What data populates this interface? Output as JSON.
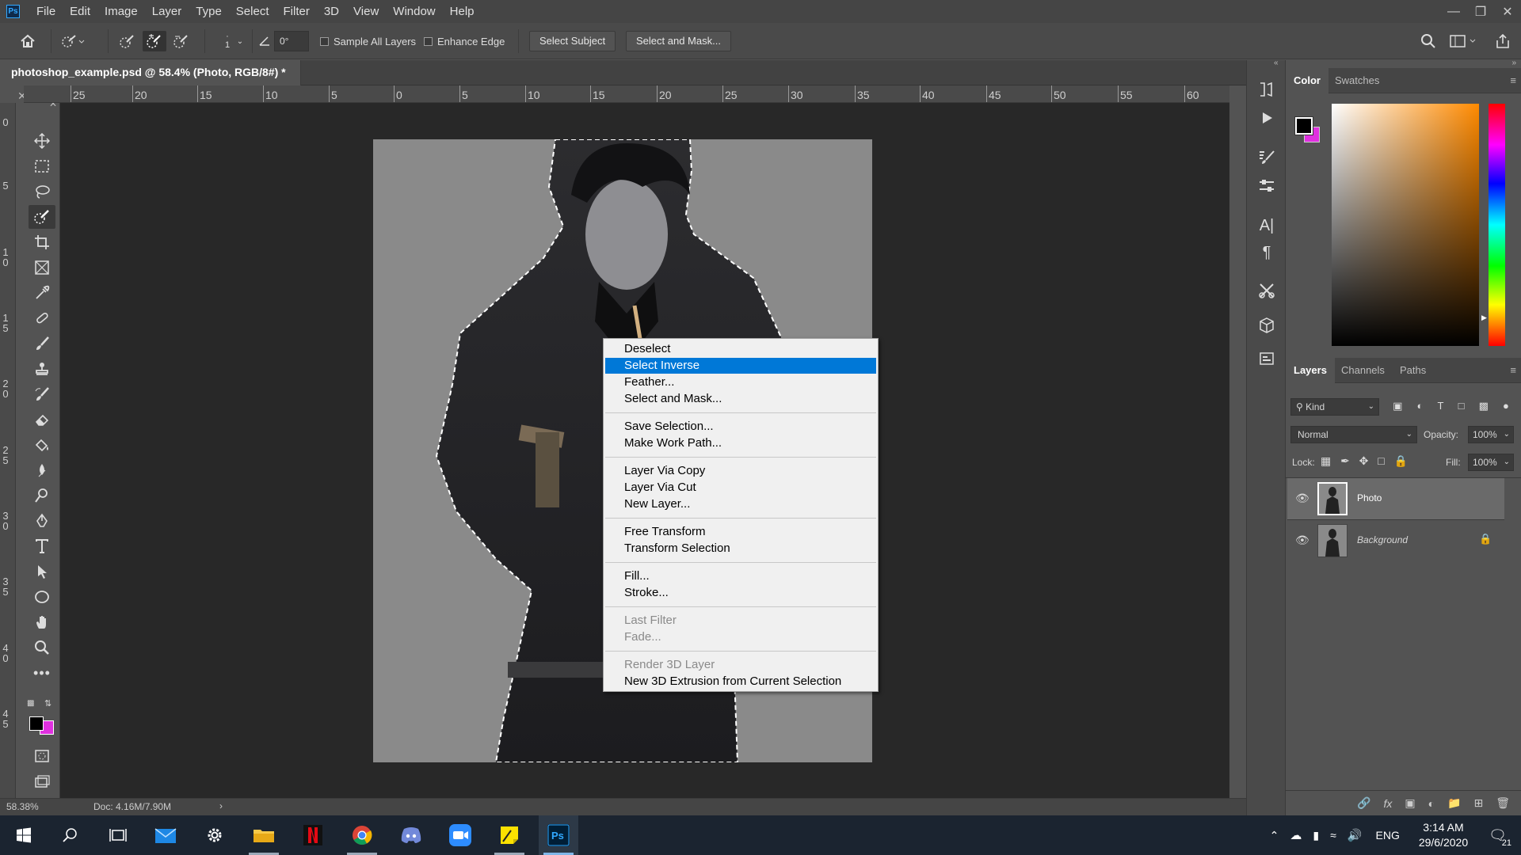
{
  "app": {
    "logo": "Ps"
  },
  "menu": [
    "File",
    "Edit",
    "Image",
    "Layer",
    "Type",
    "Select",
    "Filter",
    "3D",
    "View",
    "Window",
    "Help"
  ],
  "options": {
    "brush_size": "1",
    "angle": "0°",
    "sample_all_layers": "Sample All Layers",
    "enhance_edge": "Enhance Edge",
    "select_subject": "Select Subject",
    "select_and_mask": "Select and Mask..."
  },
  "document": {
    "tab_title": "photoshop_example.psd @ 58.4% (Photo, RGB/8#) *",
    "zoom": "58.38%",
    "doc_size": "Doc: 4.16M/7.90M"
  },
  "rulers": {
    "h": [
      "25",
      "20",
      "15",
      "10",
      "5",
      "0",
      "5",
      "10",
      "15",
      "20",
      "25",
      "30",
      "35",
      "40",
      "45",
      "50",
      "55",
      "60"
    ],
    "v": [
      "0",
      "5",
      "1\n0",
      "1\n5",
      "2\n0",
      "2\n5",
      "3\n0",
      "3\n5",
      "4\n0",
      "4\n5"
    ]
  },
  "context_menu": {
    "groups": [
      [
        "Deselect",
        "Select Inverse",
        "Feather...",
        "Select and Mask..."
      ],
      [
        "Save Selection...",
        "Make Work Path..."
      ],
      [
        "Layer Via Copy",
        "Layer Via Cut",
        "New Layer..."
      ],
      [
        "Free Transform",
        "Transform Selection"
      ],
      [
        "Fill...",
        "Stroke..."
      ],
      [
        "Last Filter",
        "Fade..."
      ],
      [
        "Render 3D Layer",
        "New 3D Extrusion from Current Selection"
      ]
    ],
    "highlighted": "Select Inverse",
    "disabled": [
      "Last Filter",
      "Fade...",
      "Render 3D Layer"
    ]
  },
  "color_panel": {
    "tabs": [
      "Color",
      "Swatches"
    ],
    "active_tab": "Color",
    "foreground": "#000000",
    "background": "#e030e0",
    "base_hue": "#ff8a00"
  },
  "layers_panel": {
    "tabs": [
      "Layers",
      "Channels",
      "Paths"
    ],
    "active_tab": "Layers",
    "kind_label": "Kind",
    "blend_mode": "Normal",
    "opacity_label": "Opacity:",
    "opacity": "100%",
    "lock_label": "Lock:",
    "fill_label": "Fill:",
    "fill": "100%",
    "layers": [
      {
        "name": "Photo",
        "visible": true,
        "selected": true,
        "locked": false
      },
      {
        "name": "Background",
        "visible": true,
        "selected": false,
        "locked": true
      }
    ]
  },
  "taskbar": {
    "apps": [
      "start",
      "search",
      "task-view",
      "mail",
      "settings",
      "file-explorer",
      "netflix",
      "chrome",
      "discord",
      "zoom",
      "sticky-notes",
      "photoshop"
    ],
    "language": "ENG",
    "time": "3:14 AM",
    "date": "29/6/2020",
    "notifications": "21"
  }
}
